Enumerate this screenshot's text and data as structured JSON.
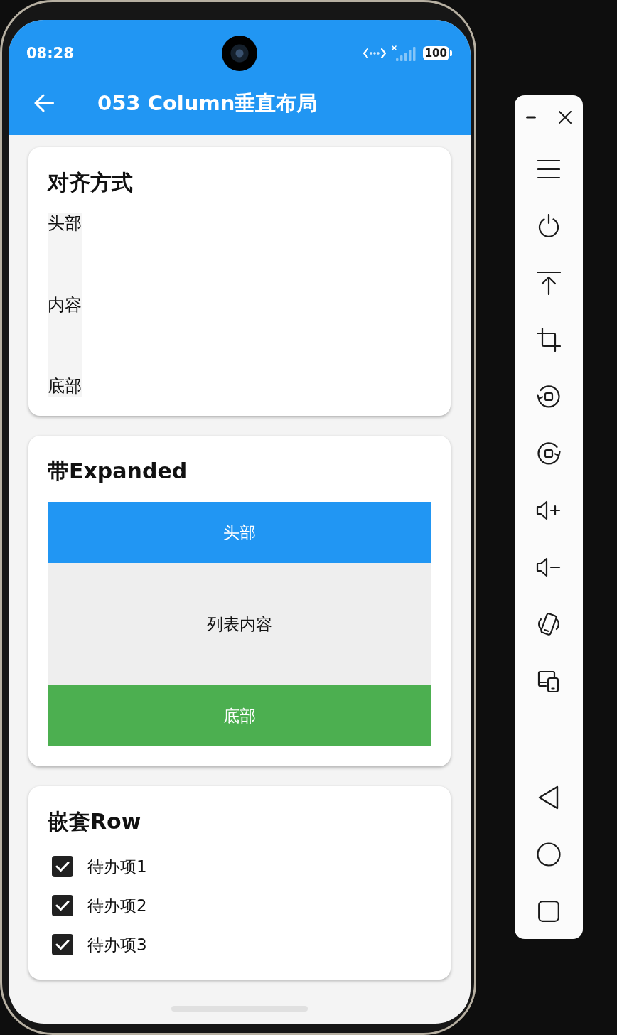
{
  "status_bar": {
    "time": "08:28",
    "battery": "100"
  },
  "app_bar": {
    "title": "053 Column垂直布局"
  },
  "cards": [
    {
      "kind": "alignment",
      "title": "对齐方式",
      "items": [
        "头部",
        "内容",
        "底部"
      ]
    },
    {
      "kind": "expanded",
      "title": "带Expanded",
      "header": "头部",
      "body": "列表内容",
      "footer": "底部"
    },
    {
      "kind": "checklist",
      "title": "嵌套Row",
      "items": [
        {
          "label": "待办项1",
          "checked": true
        },
        {
          "label": "待办项2",
          "checked": true
        },
        {
          "label": "待办项3",
          "checked": true
        }
      ]
    }
  ]
}
